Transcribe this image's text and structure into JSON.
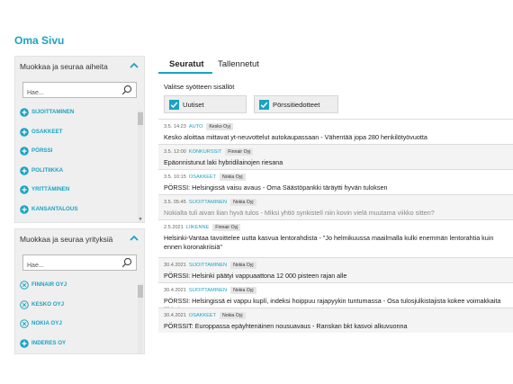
{
  "page_title": "Oma Sivu",
  "colors": {
    "accent": "#1aa3c4"
  },
  "topics_panel": {
    "title": "Muokkaa ja seuraa aiheita",
    "search_placeholder": "Hae...",
    "items": [
      {
        "label": "SIJOITTAMINEN",
        "icon": "plus-icon"
      },
      {
        "label": "OSAKKEET",
        "icon": "plus-icon"
      },
      {
        "label": "PÖRSSI",
        "icon": "plus-icon"
      },
      {
        "label": "POLITIIKKA",
        "icon": "plus-icon"
      },
      {
        "label": "YRITTÄMINEN",
        "icon": "plus-icon"
      },
      {
        "label": "KANSANTALOUS",
        "icon": "plus-icon"
      }
    ]
  },
  "companies_panel": {
    "title": "Muokkaa ja seuraa yrityksiä",
    "search_placeholder": "Hae...",
    "items": [
      {
        "label": "FINNAIR OYJ",
        "icon": "remove-icon"
      },
      {
        "label": "KESKO OYJ",
        "icon": "remove-icon"
      },
      {
        "label": "NOKIA OYJ",
        "icon": "remove-icon"
      },
      {
        "label": "INDERES OY",
        "icon": "plus-icon"
      }
    ]
  },
  "tabs": [
    {
      "label": "Seuratut",
      "active": true
    },
    {
      "label": "Tallennetut",
      "active": false
    }
  ],
  "feed_filter": {
    "label": "Valitse syötteen sisällöt",
    "options": [
      {
        "label": "Uutiset",
        "checked": true
      },
      {
        "label": "Pörssitiedotteet",
        "checked": true
      }
    ]
  },
  "news": [
    {
      "time": "3.5. 14:23",
      "category": "AUTO",
      "tag": "Kesko Oyj",
      "headline": "Kesko aloittaa mittavat yt-neuvottelut autokaupassaan - Vähentää jopa 280 henkilötyövuotta"
    },
    {
      "time": "3.5. 12:00",
      "category": "KONKURSSIT",
      "tag": "Finnair Oyj",
      "headline": "Epäonnistunut laki hybridilainojen riesana"
    },
    {
      "time": "3.5. 10:15",
      "category": "OSAKKEET",
      "tag": "Nokia Oyj",
      "headline": "PÖRSSI: Helsingissä vaisu avaus - Oma Säästöpankki täräytti hyvän tuloksen"
    },
    {
      "time": "3.5. 05:45",
      "category": "SIJOITTAMINEN",
      "tag": "Nokia Oyj",
      "headline": "Nokialta tuli aivan liian hyvä tulos - Miksi yhtiö synkistelí niin kovin vielä muutama viikko sitten?",
      "dim": true
    },
    {
      "time": "2.5.2021",
      "category": "LIIKENNE",
      "tag": "Finnair Oyj",
      "headline": "Helsinki-Vantaa tavoittelee uutta kasvua lentorahdista - \"Jo helmikuussa maailmalla kulki enemmän lentorahtia kuin ennen koronakriisiä\""
    },
    {
      "time": "30.4.2021",
      "category": "SIJOITTAMINEN",
      "tag": "Nokia Oyj",
      "headline": "PÖRSSI: Helsinki päätyi vappuaattona 12 000 pisteen rajan alle"
    },
    {
      "time": "30.4.2021",
      "category": "SIJOITTAMINEN",
      "tag": "Nokia Oyj",
      "headline": "PÖRSSI: Helsingissä ei vappu kuplí, indeksi hoippuu rajapyykin tuntumassa - Osa tulosjulkistajista kokee voimakkaita liikkeitä"
    },
    {
      "time": "30.4.2021",
      "category": "OSAKKEET",
      "tag": "Nokia Oyj",
      "headline": "PÖRSSIT: Europpassa epäyhtenäinen nousuavaus - Ranskan bkt kasvoi alkuvuonna"
    }
  ]
}
